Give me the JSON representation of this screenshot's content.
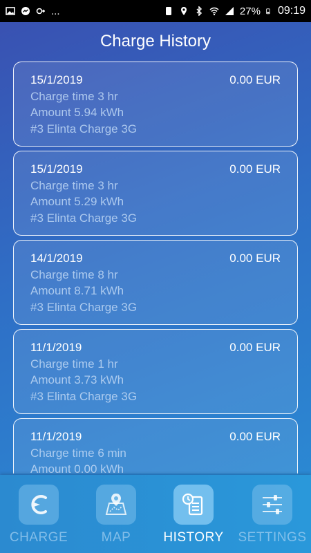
{
  "status_bar": {
    "left_icons": [
      "image-icon",
      "messenger-icon",
      "link-icon"
    ],
    "more": "...",
    "battery": "27%",
    "time": "09:19"
  },
  "page": {
    "title": "Charge History"
  },
  "history": [
    {
      "date": "15/1/2019",
      "price": "0.00 EUR",
      "charge_time": "Charge time 3 hr",
      "amount": "Amount 5.94 kWh",
      "station": "#3 Elinta Charge 3G"
    },
    {
      "date": "15/1/2019",
      "price": "0.00 EUR",
      "charge_time": "Charge time 3 hr",
      "amount": "Amount 5.29 kWh",
      "station": "#3 Elinta Charge 3G"
    },
    {
      "date": "14/1/2019",
      "price": "0.00 EUR",
      "charge_time": "Charge time 8 hr",
      "amount": "Amount 8.71 kWh",
      "station": "#3 Elinta Charge 3G"
    },
    {
      "date": "11/1/2019",
      "price": "0.00 EUR",
      "charge_time": "Charge time 1 hr",
      "amount": "Amount 3.73 kWh",
      "station": "#3 Elinta Charge 3G"
    },
    {
      "date": "11/1/2019",
      "price": "0.00 EUR",
      "charge_time": "Charge time 6 min",
      "amount": "Amount 0.00 kWh",
      "station": ""
    }
  ],
  "nav": {
    "items": [
      {
        "label": "CHARGE",
        "icon": "charge-icon"
      },
      {
        "label": "MAP",
        "icon": "map-icon"
      },
      {
        "label": "HISTORY",
        "icon": "history-icon"
      },
      {
        "label": "SETTINGS",
        "icon": "settings-icon"
      }
    ],
    "active": "HISTORY"
  }
}
